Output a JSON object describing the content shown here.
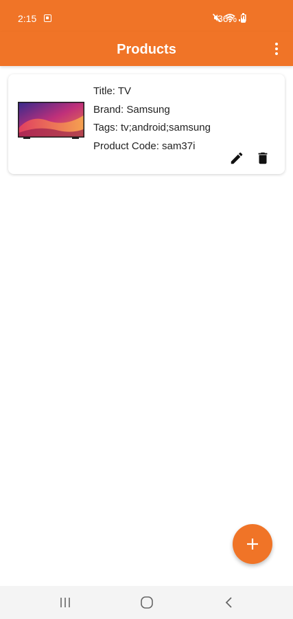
{
  "status_bar": {
    "time": "2:15",
    "battery_percent": "36%",
    "icons": [
      "gallery-notification-icon",
      "mute-icon",
      "wifi-icon",
      "signal-icon",
      "battery-icon"
    ]
  },
  "app_bar": {
    "title": "Products",
    "menu_icon": "more-vert-icon"
  },
  "products": [
    {
      "image": "tv-thumbnail",
      "title": "Title: TV",
      "brand": "Brand: Samsung",
      "tags": "Tags: tv;android;samsung",
      "code": "Product Code: sam37i",
      "actions": [
        "edit-icon",
        "delete-icon"
      ]
    }
  ],
  "fab": {
    "icon": "add-icon"
  },
  "nav_bar": {
    "buttons": [
      "recents-icon",
      "home-icon",
      "back-icon"
    ]
  },
  "colors": {
    "accent": "#f07427",
    "nav_background": "#f4f4f4",
    "icon_dark": "#111111"
  }
}
